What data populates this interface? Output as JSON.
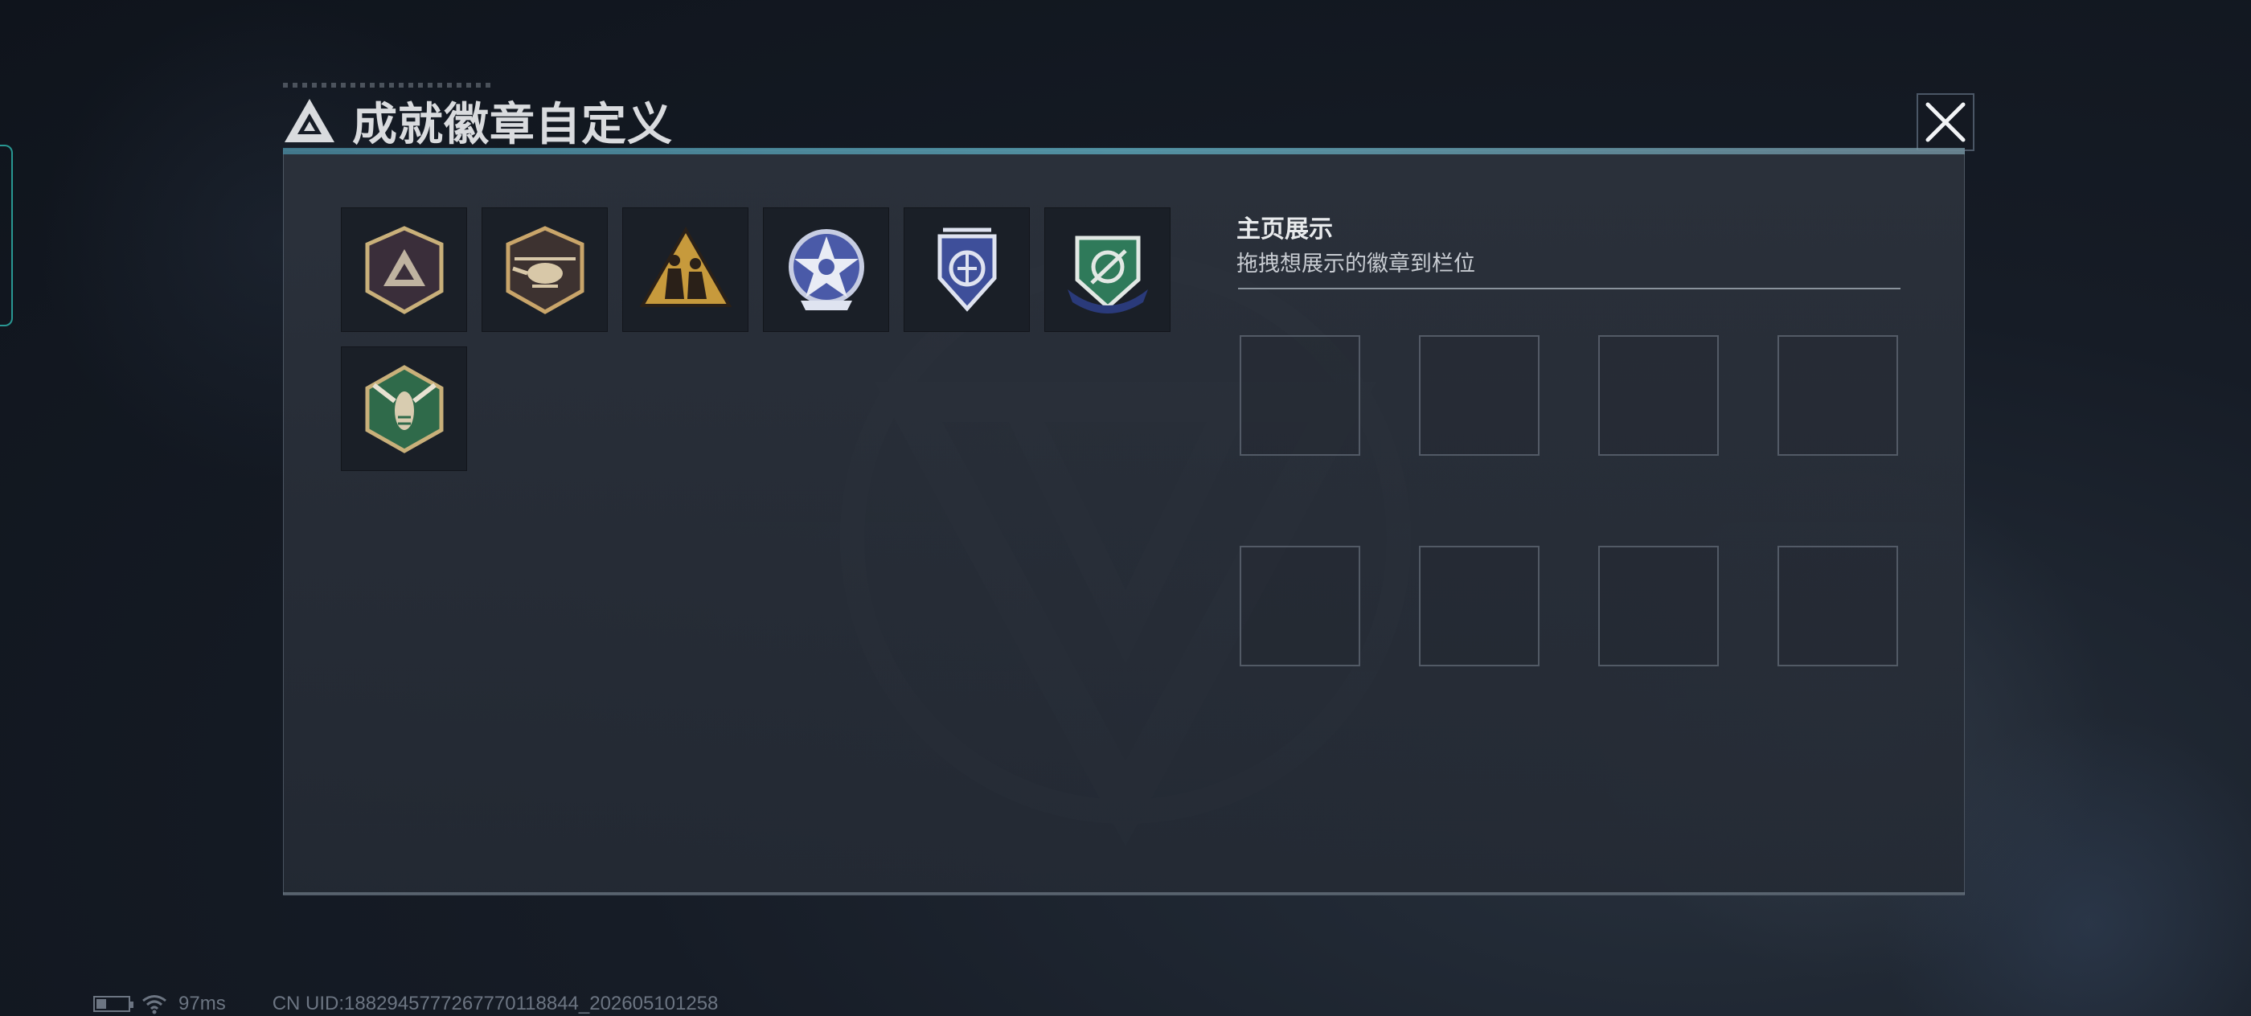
{
  "dialog": {
    "title": "成就徽章自定义",
    "close_icon": "close-icon"
  },
  "badges": [
    {
      "name": "triangle-shield-badge",
      "colors": [
        "#3a2e3a",
        "#c9b07a"
      ]
    },
    {
      "name": "helicopter-shield-badge",
      "colors": [
        "#3d3230",
        "#c9a56a"
      ]
    },
    {
      "name": "soldiers-triangle-badge",
      "colors": [
        "#c79a3c",
        "#2a2018"
      ]
    },
    {
      "name": "blue-star-badge",
      "colors": [
        "#4a5aa8",
        "#e9ecf5"
      ]
    },
    {
      "name": "blue-shield-wings-badge",
      "colors": [
        "#3e4f9a",
        "#dfe3f0"
      ]
    },
    {
      "name": "green-crest-badge",
      "colors": [
        "#2f7a5a",
        "#2a3a7a"
      ]
    },
    {
      "name": "hornet-hexagon-badge",
      "colors": [
        "#2f6a4a",
        "#c9b07a"
      ]
    }
  ],
  "showcase": {
    "title": "主页展示",
    "subtitle": "拖拽想展示的徽章到栏位",
    "slot_count": 8
  },
  "status_bar": {
    "ping": "97ms",
    "uid": "CN UID:1882945777267770118844_202605101258"
  },
  "colors": {
    "accent": "#5fb0c4",
    "panel": "#2c323c",
    "slot_border": "#78828e"
  }
}
